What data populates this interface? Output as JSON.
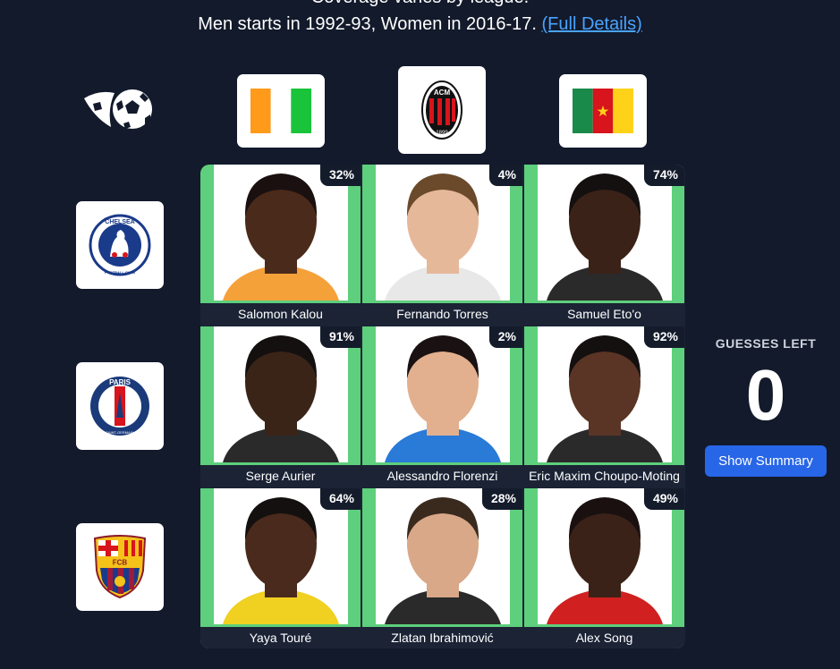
{
  "intro": {
    "cut_line": "Coverage varies by league.",
    "line2_text": "Men starts in 1992-93, Women in 2016-17. ",
    "details_link": "(Full Details)"
  },
  "columns": [
    {
      "name": "Ivory Coast",
      "icon": "ivory-coast-flag-icon"
    },
    {
      "name": "AC Milan",
      "icon": "ac-milan-crest-icon",
      "crest_text": "ACM",
      "crest_year": "1899"
    },
    {
      "name": "Cameroon",
      "icon": "cameroon-flag-icon"
    }
  ],
  "rows": [
    {
      "name": "Chelsea",
      "icon": "chelsea-crest-icon",
      "crest_text": "CHELSEA",
      "crest_sub": "FOOTBALL CLUB"
    },
    {
      "name": "Paris Saint-Germain",
      "icon": "psg-crest-icon",
      "crest_text": "PARIS",
      "crest_sub": "SAINT-GERMAIN"
    },
    {
      "name": "FC Barcelona",
      "icon": "barcelona-crest-icon",
      "crest_text": "FCB"
    }
  ],
  "cells": [
    {
      "player": "Salomon Kalou",
      "pct": "32%",
      "skin": "#4a2a1a",
      "hair": "#1a1010",
      "shirt": "#f5a13a"
    },
    {
      "player": "Fernando Torres",
      "pct": "4%",
      "skin": "#e6b89a",
      "hair": "#6a4a2a",
      "shirt": "#e8e8e8"
    },
    {
      "player": "Samuel Eto'o",
      "pct": "74%",
      "skin": "#3a2218",
      "hair": "#141010",
      "shirt": "#2a2a2a"
    },
    {
      "player": "Serge Aurier",
      "pct": "91%",
      "skin": "#3a2418",
      "hair": "#141010",
      "shirt": "#2a2a2a"
    },
    {
      "player": "Alessandro Florenzi",
      "pct": "2%",
      "skin": "#e2b08e",
      "hair": "#1a1212",
      "shirt": "#2a7ad8"
    },
    {
      "player": "Eric Maxim Choupo-Moting",
      "pct": "92%",
      "skin": "#5a3424",
      "hair": "#141010",
      "shirt": "#2a2a2a"
    },
    {
      "player": "Yaya Touré",
      "pct": "64%",
      "skin": "#4a2a1c",
      "hair": "#141010",
      "shirt": "#f0d020"
    },
    {
      "player": "Zlatan Ibrahimović",
      "pct": "28%",
      "skin": "#d8a888",
      "hair": "#3a2a1e",
      "shirt": "#2a2a2a"
    },
    {
      "player": "Alex Song",
      "pct": "49%",
      "skin": "#3a2218",
      "hair": "#1a1010",
      "shirt": "#d02020"
    }
  ],
  "sidebar": {
    "guesses_label": "GUESSES LEFT",
    "guesses_left": "0",
    "summary_button": "Show Summary"
  },
  "colors": {
    "background": "#121a2b",
    "correct_cell": "#5ecf7c",
    "link": "#4aa3ff",
    "button": "#2866e8"
  }
}
